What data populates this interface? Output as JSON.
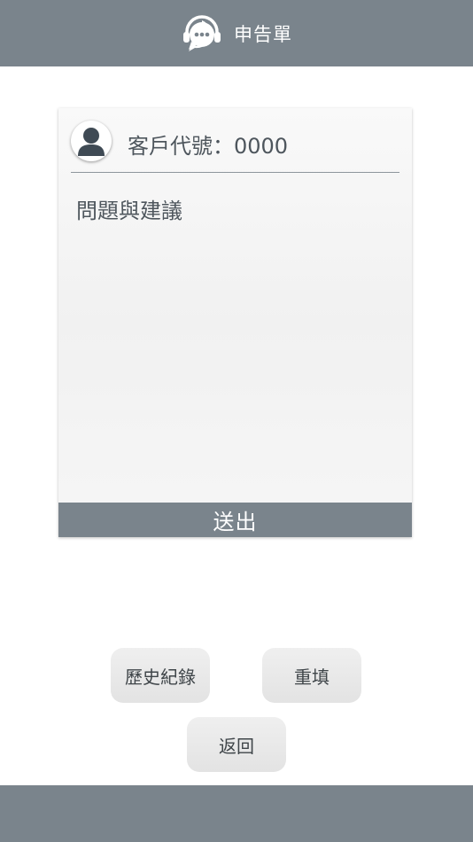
{
  "header": {
    "title": "申告單",
    "icon": "headset-chat-icon"
  },
  "card": {
    "avatar_icon": "user-avatar-icon",
    "customer_id": "客戶代號：0000",
    "feedback_placeholder": "問題與建議",
    "submit_label": "送出"
  },
  "actions": {
    "history_label": "歷史紀錄",
    "reset_label": "重填",
    "back_label": "返回"
  },
  "colors": {
    "bar": "#7a848c",
    "button_bg": "#e8e8e8",
    "text": "#4e565d"
  }
}
